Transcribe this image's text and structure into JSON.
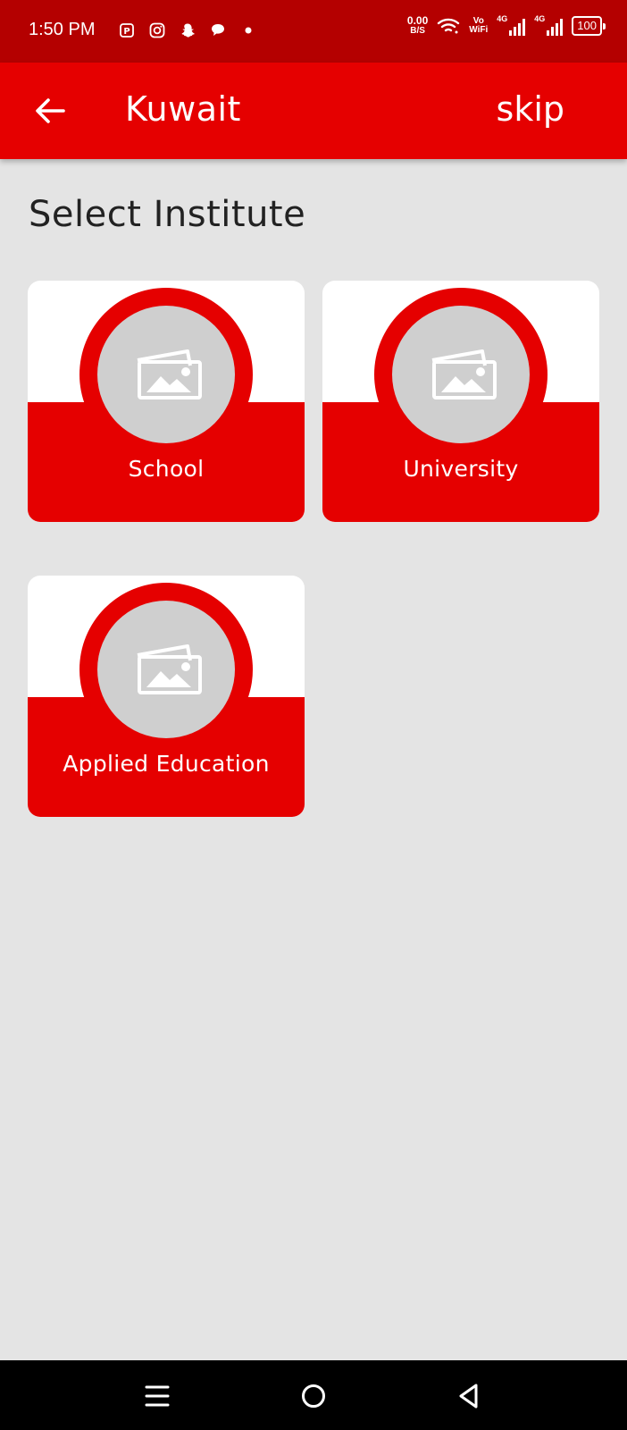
{
  "status_bar": {
    "time": "1:50 PM",
    "net_speed_value": "0.00",
    "net_speed_unit": "B/S",
    "vowifi_top": "Vo",
    "vowifi_bottom": "WiFi",
    "signal_label_1": "4G",
    "signal_label_2": "4G",
    "battery": "100",
    "icons": [
      "phonepe-icon",
      "instagram-icon",
      "snapchat-icon",
      "chat-icon",
      "dot-icon",
      "wifi-icon",
      "signal-icon",
      "battery-icon"
    ]
  },
  "app_bar": {
    "title": "Kuwait",
    "skip_label": "skip",
    "back_icon": "arrow-left-icon"
  },
  "page": {
    "section_title": "Select Institute"
  },
  "institutes": [
    {
      "label": "School",
      "icon": "image-placeholder-icon"
    },
    {
      "label": "University",
      "icon": "image-placeholder-icon"
    },
    {
      "label": "Applied Education",
      "icon": "image-placeholder-icon"
    }
  ],
  "nav_bar": {
    "icons": [
      "menu-icon",
      "home-icon",
      "back-icon"
    ]
  },
  "colors": {
    "status_bar": "#b40000",
    "accent": "#e50000",
    "background": "#e4e4e4",
    "placeholder": "#cfcfcf"
  }
}
